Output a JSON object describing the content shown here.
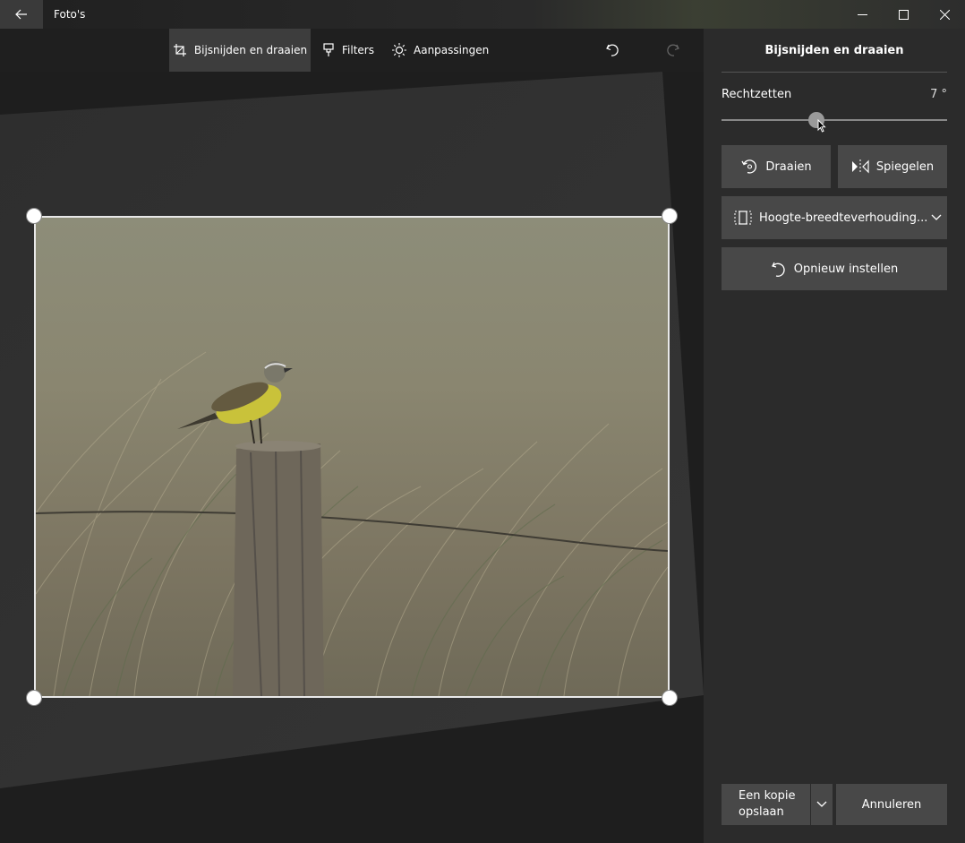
{
  "window": {
    "title": "Foto's"
  },
  "toolbar": {
    "crop_label": "Bijsnijden en draaien",
    "filters_label": "Filters",
    "adjust_label": "Aanpassingen"
  },
  "panel": {
    "title": "Bijsnijden en draaien",
    "straighten_label": "Rechtzetten",
    "straighten_value": "7 °",
    "straighten_level": 7,
    "rotate_label": "Draaien",
    "mirror_label": "Spiegelen",
    "aspect_label": "Hoogte-breedteverhouding...",
    "reset_label": "Opnieuw instellen",
    "save_copy_line1": "Een kopie",
    "save_copy_line2": "opslaan",
    "cancel_label": "Annuleren"
  },
  "icons": {
    "back": "arrow-left-icon",
    "minimize": "minimize-icon",
    "maximize": "maximize-icon",
    "close": "close-icon",
    "crop": "crop-icon",
    "filters": "brush-icon",
    "adjust": "sun-icon",
    "undo": "undo-icon",
    "redo": "redo-icon",
    "rotate": "rotate-icon",
    "mirror": "mirror-icon",
    "aspect": "aspect-ratio-icon",
    "reset": "reset-icon",
    "chevron": "chevron-down-icon"
  },
  "colors": {
    "background": "#1f1f1f",
    "panel": "#2b2b2b",
    "button": "#484848",
    "active_tool": "#3d3d3d"
  }
}
